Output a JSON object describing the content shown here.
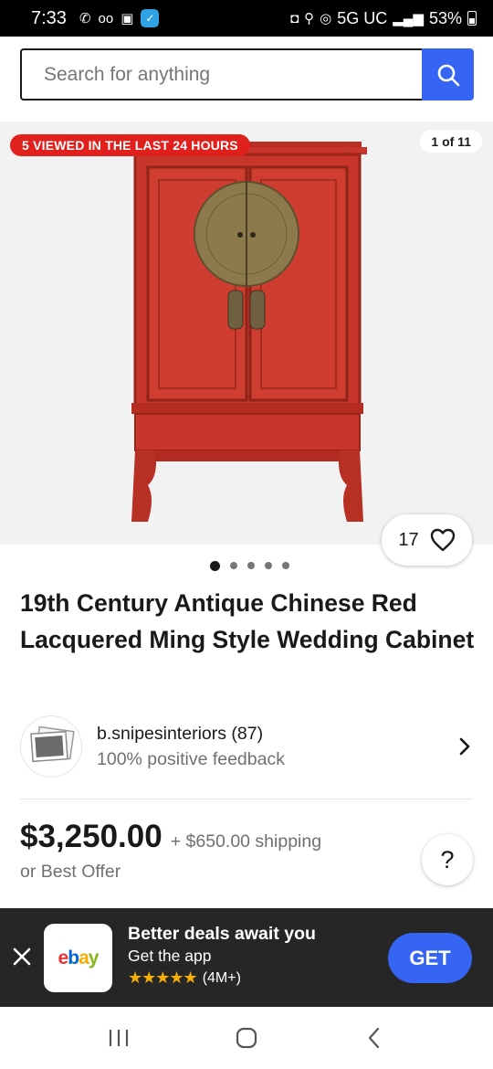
{
  "status_bar": {
    "time": "7:33",
    "network": "5G UC",
    "battery": "53%"
  },
  "search": {
    "placeholder": "Search for anything"
  },
  "gallery": {
    "viewed_badge": "5 VIEWED IN THE LAST 24 HOURS",
    "image_counter": "1 of 11",
    "watch_count": "17",
    "dot_count": 5,
    "active_dot": 0
  },
  "listing": {
    "title": "19th Century Antique Chinese Red Lacquered Ming Style Wedding Cabinet"
  },
  "seller": {
    "name": "b.snipesinteriors (87)",
    "feedback": "100% positive feedback"
  },
  "pricing": {
    "price": "$3,250.00",
    "shipping": "+ $650.00 shipping",
    "best_offer": "or Best Offer",
    "help_label": "?"
  },
  "app_banner": {
    "app_name": "ebay",
    "headline": "Better deals await you",
    "subline": "Get the app",
    "stars": "★★★★★",
    "rating_count": "(4M+)",
    "get_label": "GET"
  },
  "colors": {
    "accent_blue": "#3665f3",
    "badge_red": "#e0201c",
    "cabinet_red": "#c8352a",
    "banner_bg": "#262626"
  }
}
